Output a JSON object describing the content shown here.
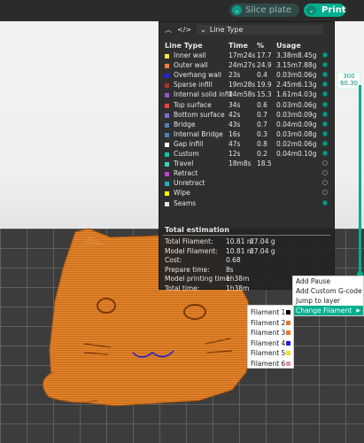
{
  "toolbar": {
    "slice_label": "Slice plate",
    "print_label": "Print",
    "dropdown_glyph": "⌄"
  },
  "legend": {
    "view_type": "Line Type",
    "columns": [
      "Line Type",
      "Time",
      "%",
      "Usage"
    ],
    "rows": [
      {
        "name": "Inner wall",
        "time": "17m24s",
        "pct": "17.7",
        "usage_m": "3.38m",
        "usage_g": "8.45g",
        "color": "#ffe640",
        "visible": true
      },
      {
        "name": "Outer wall",
        "time": "24m27s",
        "pct": "24.9",
        "usage_m": "3.15m",
        "usage_g": "7.88g",
        "color": "#ff7d38",
        "visible": true
      },
      {
        "name": "Overhang wall",
        "time": "23s",
        "pct": "0.4",
        "usage_m": "0.03m",
        "usage_g": "0.06g",
        "color": "#1f1fff",
        "visible": true
      },
      {
        "name": "Sparse infill",
        "time": "19m28s",
        "pct": "19.9",
        "usage_m": "2.45m",
        "usage_g": "6.13g",
        "color": "#b03029",
        "visible": true
      },
      {
        "name": "Internal solid infill",
        "time": "14m58s",
        "pct": "15.3",
        "usage_m": "1.61m",
        "usage_g": "4.03g",
        "color": "#9654cc",
        "visible": true
      },
      {
        "name": "Top surface",
        "time": "34s",
        "pct": "0.6",
        "usage_m": "0.03m",
        "usage_g": "0.06g",
        "color": "#f04040",
        "visible": true
      },
      {
        "name": "Bottom surface",
        "time": "42s",
        "pct": "0.7",
        "usage_m": "0.03m",
        "usage_g": "0.09g",
        "color": "#7d6bd9",
        "visible": true
      },
      {
        "name": "Bridge",
        "time": "43s",
        "pct": "0.7",
        "usage_m": "0.04m",
        "usage_g": "0.09g",
        "color": "#4d80ba",
        "visible": true
      },
      {
        "name": "Internal Bridge",
        "time": "16s",
        "pct": "0.3",
        "usage_m": "0.03m",
        "usage_g": "0.08g",
        "color": "#4d80ba",
        "visible": true
      },
      {
        "name": "Gap infill",
        "time": "47s",
        "pct": "0.8",
        "usage_m": "0.02m",
        "usage_g": "0.06g",
        "color": "#ffffff",
        "visible": true
      },
      {
        "name": "Custom",
        "time": "12s",
        "pct": "0.2",
        "usage_m": "0.04m",
        "usage_g": "0.10g",
        "color": "#00c8a0",
        "visible": true
      },
      {
        "name": "Travel",
        "time": "18m8s",
        "pct": "18.5",
        "usage_m": "",
        "usage_g": "",
        "color": "#38d9ab",
        "visible": false
      },
      {
        "name": "Retract",
        "time": "",
        "pct": "",
        "usage_m": "",
        "usage_g": "",
        "color": "#c43bd9",
        "visible": false
      },
      {
        "name": "Unretract",
        "time": "",
        "pct": "",
        "usage_m": "",
        "usage_g": "",
        "color": "#1ab3c4",
        "visible": false
      },
      {
        "name": "Wipe",
        "time": "",
        "pct": "",
        "usage_m": "",
        "usage_g": "",
        "color": "#ffff00",
        "visible": false
      },
      {
        "name": "Seams",
        "time": "",
        "pct": "",
        "usage_m": "",
        "usage_g": "",
        "color": "#e6e6e6",
        "visible": true
      }
    ]
  },
  "estimation": {
    "title": "Total estimation",
    "rows": [
      {
        "label": "Total Filament:",
        "v1": "10.81 m",
        "v2": "27.04 g"
      },
      {
        "label": "Model Filament:",
        "v1": "10.81 m",
        "v2": "27.04 g"
      },
      {
        "label": "Cost:",
        "v1": "0.68",
        "v2": ""
      },
      {
        "label": "Prepare time:",
        "v1": "8s",
        "v2": ""
      },
      {
        "label": "Model printing time:",
        "v1": "1h38m",
        "v2": ""
      },
      {
        "label": "Total time:",
        "v1": "1h38m",
        "v2": ""
      }
    ]
  },
  "layer_slider": {
    "top_layer": "300",
    "top_height": "60.30"
  },
  "context_menu": {
    "items": [
      "Add Pause",
      "Add Custom G-code",
      "Jump to layer",
      "Change Filament"
    ],
    "active_index": 3,
    "submenu_arrow": "▶"
  },
  "filament_submenu": [
    {
      "label": "Filament 1",
      "color": "#000000"
    },
    {
      "label": "Filament 2",
      "color": "#e07a30"
    },
    {
      "label": "Filament 3",
      "color": "#e07a30"
    },
    {
      "label": "Filament 4",
      "color": "#2020d0"
    },
    {
      "label": "Filament 5",
      "color": "#f2e033"
    },
    {
      "label": "Filament 6",
      "color": "#e890b0"
    }
  ],
  "icons": [
    "collapse-icon",
    "code-icon",
    "chevron-down-icon",
    "eye-icon",
    "submenu-arrow-icon"
  ]
}
